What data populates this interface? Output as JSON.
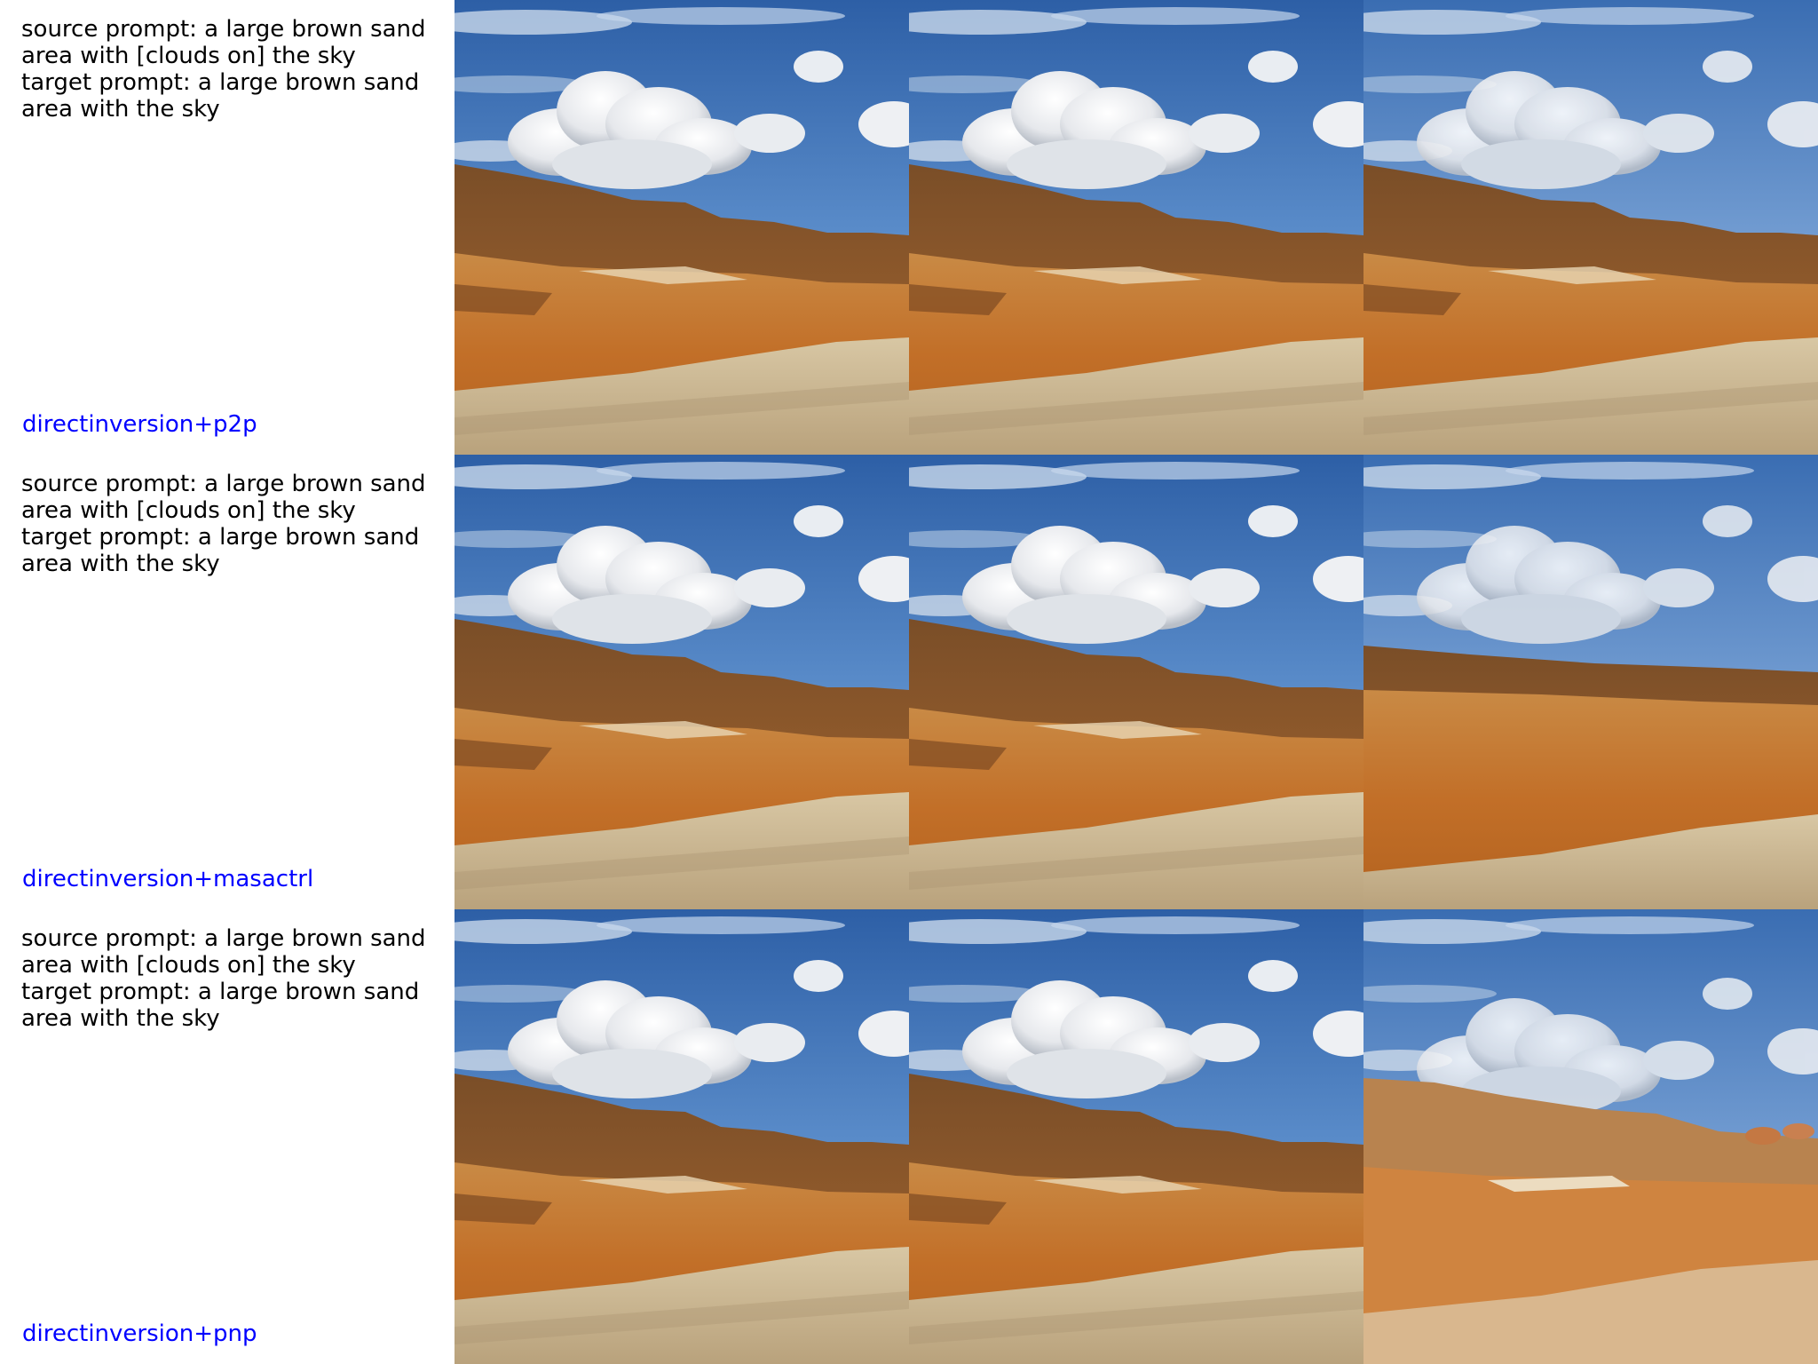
{
  "rows": [
    {
      "prompt": "source prompt: a large brown sand\narea with [clouds on] the sky\ntarget prompt: a large brown sand\narea with the sky",
      "method": "directinversion+p2p"
    },
    {
      "prompt": "source prompt: a large brown sand\narea with [clouds on] the sky\ntarget prompt: a large brown sand\narea with the sky",
      "method": "directinversion+masactrl"
    },
    {
      "prompt": "source prompt: a large brown sand\narea with [clouds on] the sky\ntarget prompt: a large brown sand\narea with the sky",
      "method": "directinversion+pnp"
    }
  ],
  "colors": {
    "prompt_text": "#000000",
    "method_text": "#0000ff",
    "sky_top": "#2f64a8",
    "sky_bottom": "#9fbfe0",
    "cloud": "#f2f2f2",
    "hill": "#8a5a2e",
    "sand": "#c47a32",
    "rock": "#cdbb98"
  }
}
